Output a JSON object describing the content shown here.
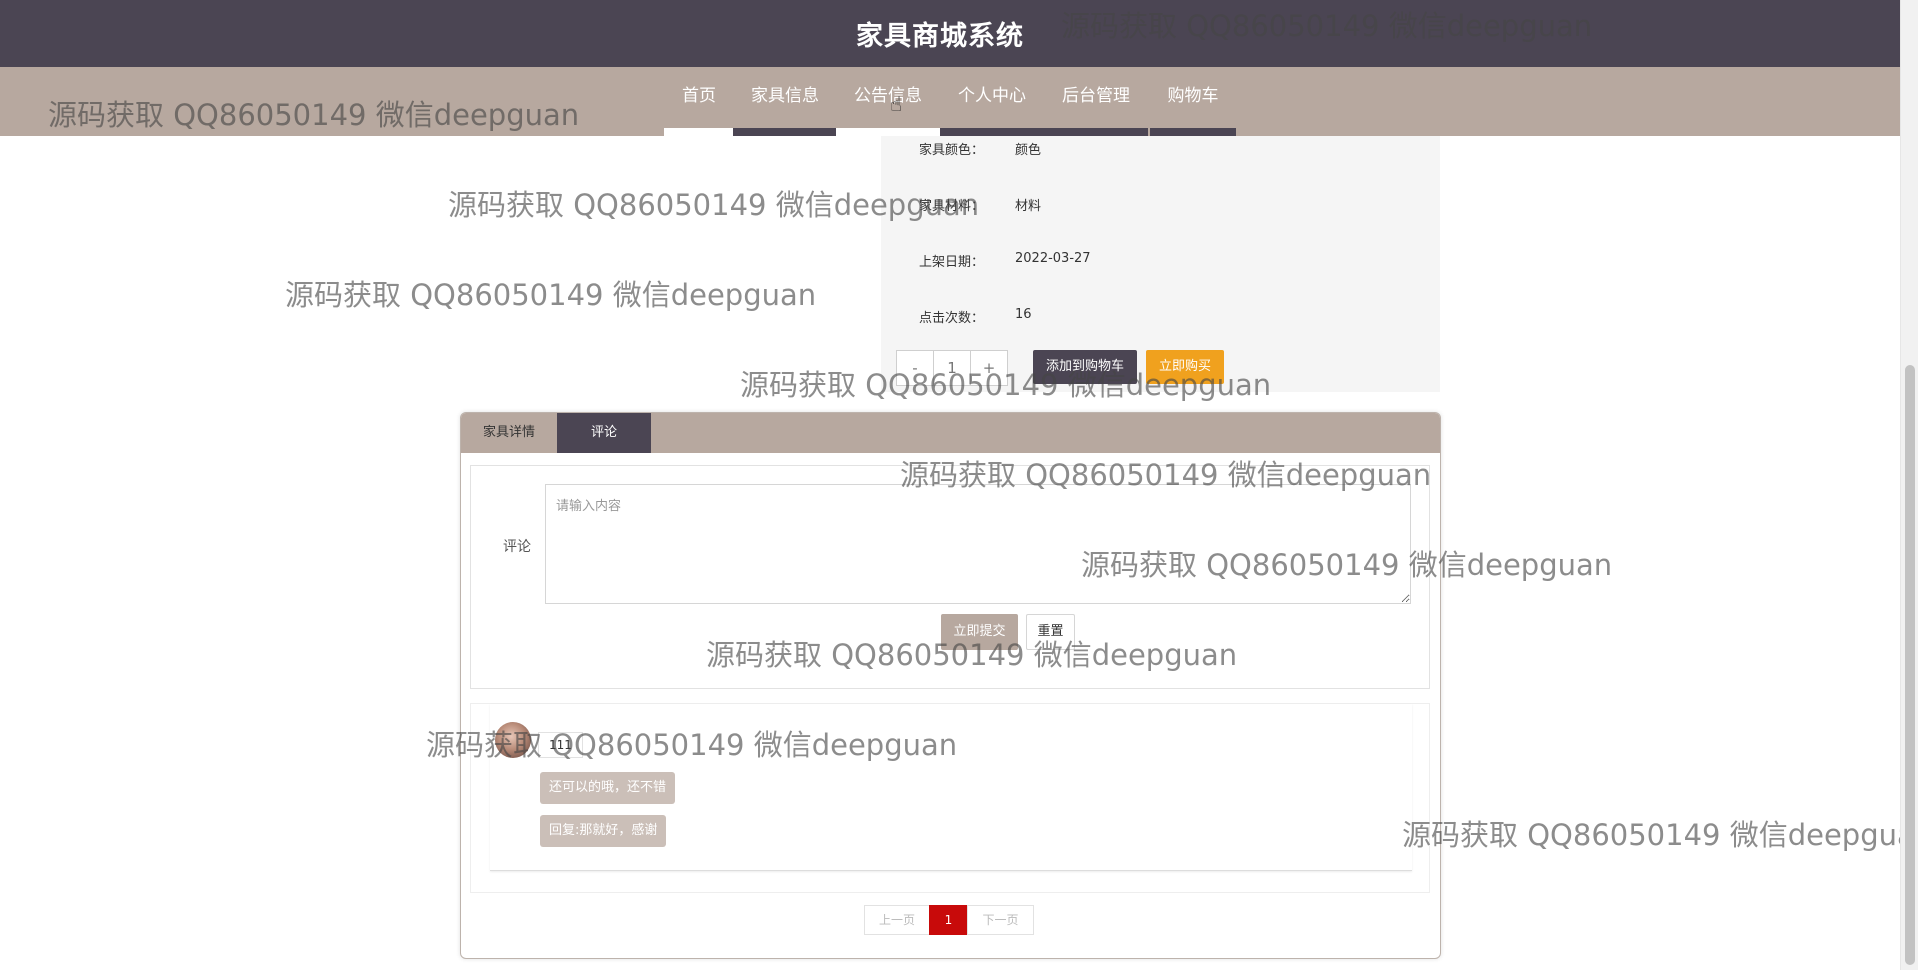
{
  "header": {
    "title": "家具商城系统"
  },
  "nav": {
    "items": [
      {
        "label": "首页",
        "active": true
      },
      {
        "label": "家具信息",
        "active": false
      },
      {
        "label": "公告信息",
        "active": false
      },
      {
        "label": "个人中心",
        "active": false
      },
      {
        "label": "后台管理",
        "active": false
      },
      {
        "label": "购物车",
        "active": false
      }
    ]
  },
  "product_info": {
    "rows": [
      {
        "label": "家具颜色：",
        "value": "颜色"
      },
      {
        "label": "家具材料：",
        "value": "材料"
      },
      {
        "label": "上架日期：",
        "value": "2022-03-27"
      },
      {
        "label": "点击次数：",
        "value": "16"
      }
    ],
    "quantity": {
      "minus": "-",
      "value": "1",
      "plus": "+"
    },
    "add_to_cart_label": "添加到购物车",
    "buy_now_label": "立即购买"
  },
  "tabs": [
    {
      "label": "家具详情",
      "active": false
    },
    {
      "label": "评论",
      "active": true
    }
  ],
  "comment_form": {
    "label": "评论",
    "placeholder": "请输入内容",
    "submit_label": "立即提交",
    "reset_label": "重置"
  },
  "comments": [
    {
      "user": "111",
      "content": "还可以的哦，还不错",
      "reply": "回复:那就好，感谢"
    }
  ],
  "pagination": {
    "prev": "上一页",
    "current": "1",
    "next": "下一页"
  },
  "watermark": "源码获取 QQ86050149 微信deepguan",
  "colors": {
    "header_bg": "#4b4553",
    "nav_bg": "#b7a89f",
    "buy_button": "#f0a11e",
    "current_page": "#c80a0a"
  }
}
